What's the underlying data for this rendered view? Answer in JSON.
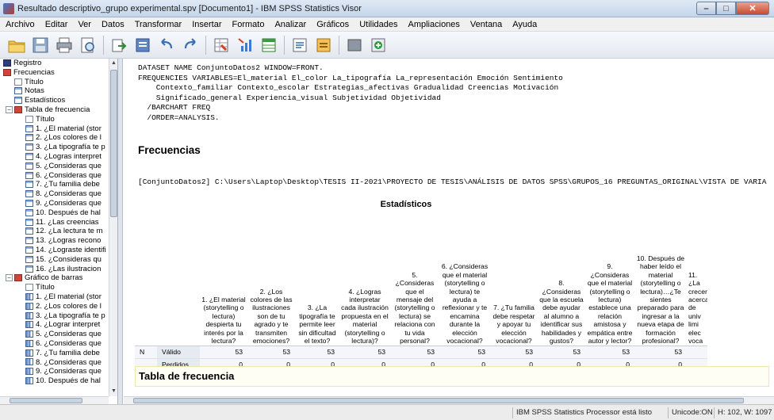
{
  "window": {
    "title": "Resultado descriptivo_grupo experimental.spv [Documento1] - IBM SPSS Statistics Visor",
    "controls": {
      "minimize": "–",
      "maximize": "□",
      "close": "✕"
    }
  },
  "menu": [
    "Archivo",
    "Editar",
    "Ver",
    "Datos",
    "Transformar",
    "Insertar",
    "Formato",
    "Analizar",
    "Gráficos",
    "Utilidades",
    "Ampliaciones",
    "Ventana",
    "Ayuda"
  ],
  "toolbar": {
    "icons": [
      "open-folder-icon",
      "save-icon",
      "print-icon",
      "print-preview-icon",
      "export-icon",
      "recall-dialog-icon",
      "undo-icon",
      "redo-icon",
      "goto-data-icon",
      "goto-case-icon",
      "variables-icon",
      "insert-output-icon",
      "designate-window-icon",
      "select-last-output-icon",
      "run-syntax-icon"
    ]
  },
  "tree": {
    "items": [
      {
        "label": "Registro",
        "level": 0,
        "icon": "book-icon",
        "expander": ""
      },
      {
        "label": "Frecuencias",
        "level": 0,
        "icon": "red-item-icon",
        "expander": ""
      },
      {
        "label": "Título",
        "level": 1,
        "icon": "doc-icon",
        "expander": ""
      },
      {
        "label": "Notas",
        "level": 1,
        "icon": "notes-icon",
        "expander": ""
      },
      {
        "label": "Estadísticos",
        "level": 1,
        "icon": "table-icon",
        "expander": ""
      },
      {
        "label": "Tabla de frecuencia",
        "level": 1,
        "icon": "red-item-icon",
        "expander": "−"
      },
      {
        "label": "Título",
        "level": 2,
        "icon": "doc-icon",
        "expander": ""
      },
      {
        "label": "1. ¿El material (stor",
        "level": 2,
        "icon": "table-icon",
        "expander": ""
      },
      {
        "label": "2. ¿Los colores de l",
        "level": 2,
        "icon": "table-icon",
        "expander": ""
      },
      {
        "label": "3. ¿La tipografía te p",
        "level": 2,
        "icon": "table-icon",
        "expander": ""
      },
      {
        "label": "4. ¿Logras interpret",
        "level": 2,
        "icon": "table-icon",
        "expander": ""
      },
      {
        "label": "5. ¿Consideras que",
        "level": 2,
        "icon": "table-icon",
        "expander": ""
      },
      {
        "label": "6. ¿Consideras que",
        "level": 2,
        "icon": "table-icon",
        "expander": ""
      },
      {
        "label": "7. ¿Tu familia debe",
        "level": 2,
        "icon": "table-icon",
        "expander": ""
      },
      {
        "label": "8. ¿Consideras que",
        "level": 2,
        "icon": "table-icon",
        "expander": ""
      },
      {
        "label": "9. ¿Consideras que",
        "level": 2,
        "icon": "table-icon",
        "expander": ""
      },
      {
        "label": "10. Después de hal",
        "level": 2,
        "icon": "table-icon",
        "expander": ""
      },
      {
        "label": "11. ¿Las creencias",
        "level": 2,
        "icon": "table-icon",
        "expander": ""
      },
      {
        "label": "12. ¿La lectura te m",
        "level": 2,
        "icon": "table-icon",
        "expander": ""
      },
      {
        "label": "13. ¿Logras recono",
        "level": 2,
        "icon": "table-icon",
        "expander": ""
      },
      {
        "label": "14. ¿Lograste identifi",
        "level": 2,
        "icon": "table-icon",
        "expander": ""
      },
      {
        "label": "15. ¿Consideras qu",
        "level": 2,
        "icon": "table-icon",
        "expander": ""
      },
      {
        "label": "16. ¿Las ilustracion",
        "level": 2,
        "icon": "table-icon",
        "expander": ""
      },
      {
        "label": "Gráfico de barras",
        "level": 1,
        "icon": "red-item-icon",
        "expander": "−"
      },
      {
        "label": "Título",
        "level": 2,
        "icon": "doc-icon",
        "expander": ""
      },
      {
        "label": "1. ¿El material (stor",
        "level": 2,
        "icon": "chart-icon",
        "expander": ""
      },
      {
        "label": "2. ¿Los colores de l",
        "level": 2,
        "icon": "chart-icon",
        "expander": ""
      },
      {
        "label": "3. ¿La tipografía te p",
        "level": 2,
        "icon": "chart-icon",
        "expander": ""
      },
      {
        "label": "4. ¿Lograr interpret",
        "level": 2,
        "icon": "chart-icon",
        "expander": ""
      },
      {
        "label": "5. ¿Consideras que",
        "level": 2,
        "icon": "chart-icon",
        "expander": ""
      },
      {
        "label": "6. ¿Consideras que",
        "level": 2,
        "icon": "chart-icon",
        "expander": ""
      },
      {
        "label": "7. ¿Tu familia debe",
        "level": 2,
        "icon": "chart-icon",
        "expander": ""
      },
      {
        "label": "8. ¿Consideras que",
        "level": 2,
        "icon": "chart-icon",
        "expander": ""
      },
      {
        "label": "9. ¿Consideras que",
        "level": 2,
        "icon": "chart-icon",
        "expander": ""
      },
      {
        "label": "10. Después de hal",
        "level": 2,
        "icon": "chart-icon",
        "expander": ""
      }
    ]
  },
  "output": {
    "syntax": "DATASET NAME ConjuntoDatos2 WINDOW=FRONT.\nFREQUENCIES VARIABLES=El_material El_color La_tipografía La_representación Emoción Sentimiento\n    Contexto_familiar Contexto_escolar Estrategias_afectivas Gradualidad Creencias Motivación\n    Significado_general Experiencia_visual Subjetividad Objetividad\n  /BARCHART FREQ\n  /ORDER=ANALYSIS.",
    "heading_frecuencias": "Frecuencias",
    "dataset_line": "[ConjuntoDatos2] C:\\Users\\Laptop\\Desktop\\TESIS II-2021\\PROYECTO DE TESIS\\ANÁLISIS DE DATOS SPSS\\GRUPOS_16 PREGUNTAS_ORIGINAL\\VISTA DE VARIA",
    "stats_title": "Estadísticos",
    "stats_columns": [
      "1. ¿El material (storytelling o lectura) despierta tu interés por la lectura?",
      "2. ¿Los colores de las ilustraciones son de tu agrado y te transmiten emociones?",
      "3. ¿La tipografía te permite leer sin dificultad el texto?",
      "4. ¿Logras interpretar cada ilustración propuesta en el material (storytelling o lectura)?",
      "5. ¿Consideras que el mensaje del (storytelling o lectura) se relaciona con tu vida personal?",
      "6. ¿Consideras que el material (storytelling o lectura) te ayuda a reflexionar y te encamina durante la elección vocacional?",
      "7. ¿Tu familia debe respetar y apoyar tu elección vocacional?",
      "8. ¿Consideras que la escuela debe ayudar al alumno a identificar sus habilidades y gustos?",
      "9. ¿Consideras que el material (storytelling o lectura) establece una relación amistosa y empática entre autor y lector?",
      "10. Después de haber leído el material (storytelling o lectura)…¿Te sientes preparado para ingresar a la nueva etapa de formación profesional?",
      "11. ¿La crecencia acerca de univ limi elec voca"
    ],
    "stats_n_label": "N",
    "stats_rows": [
      {
        "label": "Válido",
        "values": [
          "53",
          "53",
          "53",
          "53",
          "53",
          "53",
          "53",
          "53",
          "53",
          "53",
          ""
        ]
      },
      {
        "label": "Perdidos",
        "values": [
          "0",
          "0",
          "0",
          "0",
          "0",
          "0",
          "0",
          "0",
          "0",
          "0",
          ""
        ]
      }
    ],
    "heading_tabla": "Tabla de frecuencia"
  },
  "status": {
    "processor": "IBM SPSS Statistics Processor está listo",
    "unicode": "Unicode:ON",
    "size": "H: 102, W: 1097 p"
  }
}
